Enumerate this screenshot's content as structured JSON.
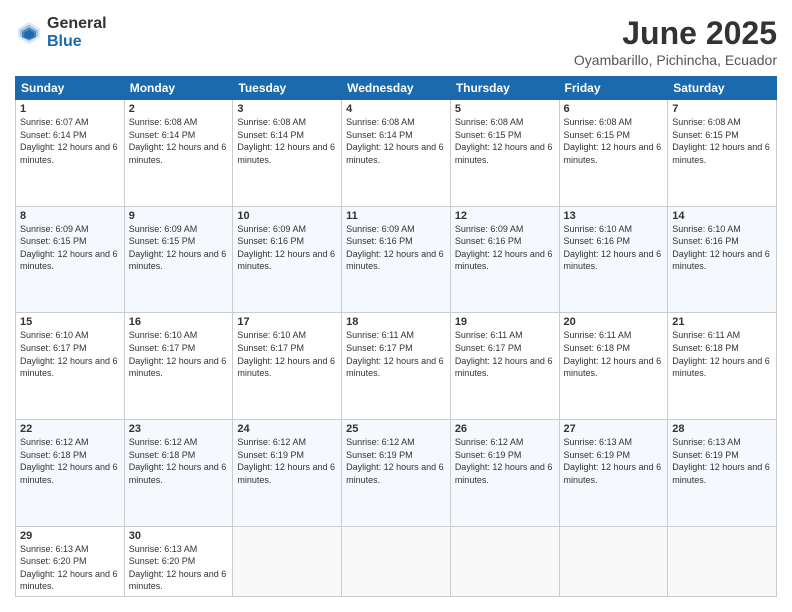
{
  "logo": {
    "general": "General",
    "blue": "Blue"
  },
  "title": "June 2025",
  "location": "Oyambarillo, Pichincha, Ecuador",
  "headers": [
    "Sunday",
    "Monday",
    "Tuesday",
    "Wednesday",
    "Thursday",
    "Friday",
    "Saturday"
  ],
  "weeks": [
    [
      {
        "day": "1",
        "sunrise": "6:07 AM",
        "sunset": "6:14 PM",
        "daylight": "12 hours and 6 minutes."
      },
      {
        "day": "2",
        "sunrise": "6:08 AM",
        "sunset": "6:14 PM",
        "daylight": "12 hours and 6 minutes."
      },
      {
        "day": "3",
        "sunrise": "6:08 AM",
        "sunset": "6:14 PM",
        "daylight": "12 hours and 6 minutes."
      },
      {
        "day": "4",
        "sunrise": "6:08 AM",
        "sunset": "6:14 PM",
        "daylight": "12 hours and 6 minutes."
      },
      {
        "day": "5",
        "sunrise": "6:08 AM",
        "sunset": "6:15 PM",
        "daylight": "12 hours and 6 minutes."
      },
      {
        "day": "6",
        "sunrise": "6:08 AM",
        "sunset": "6:15 PM",
        "daylight": "12 hours and 6 minutes."
      },
      {
        "day": "7",
        "sunrise": "6:08 AM",
        "sunset": "6:15 PM",
        "daylight": "12 hours and 6 minutes."
      }
    ],
    [
      {
        "day": "8",
        "sunrise": "6:09 AM",
        "sunset": "6:15 PM",
        "daylight": "12 hours and 6 minutes."
      },
      {
        "day": "9",
        "sunrise": "6:09 AM",
        "sunset": "6:15 PM",
        "daylight": "12 hours and 6 minutes."
      },
      {
        "day": "10",
        "sunrise": "6:09 AM",
        "sunset": "6:16 PM",
        "daylight": "12 hours and 6 minutes."
      },
      {
        "day": "11",
        "sunrise": "6:09 AM",
        "sunset": "6:16 PM",
        "daylight": "12 hours and 6 minutes."
      },
      {
        "day": "12",
        "sunrise": "6:09 AM",
        "sunset": "6:16 PM",
        "daylight": "12 hours and 6 minutes."
      },
      {
        "day": "13",
        "sunrise": "6:10 AM",
        "sunset": "6:16 PM",
        "daylight": "12 hours and 6 minutes."
      },
      {
        "day": "14",
        "sunrise": "6:10 AM",
        "sunset": "6:16 PM",
        "daylight": "12 hours and 6 minutes."
      }
    ],
    [
      {
        "day": "15",
        "sunrise": "6:10 AM",
        "sunset": "6:17 PM",
        "daylight": "12 hours and 6 minutes."
      },
      {
        "day": "16",
        "sunrise": "6:10 AM",
        "sunset": "6:17 PM",
        "daylight": "12 hours and 6 minutes."
      },
      {
        "day": "17",
        "sunrise": "6:10 AM",
        "sunset": "6:17 PM",
        "daylight": "12 hours and 6 minutes."
      },
      {
        "day": "18",
        "sunrise": "6:11 AM",
        "sunset": "6:17 PM",
        "daylight": "12 hours and 6 minutes."
      },
      {
        "day": "19",
        "sunrise": "6:11 AM",
        "sunset": "6:17 PM",
        "daylight": "12 hours and 6 minutes."
      },
      {
        "day": "20",
        "sunrise": "6:11 AM",
        "sunset": "6:18 PM",
        "daylight": "12 hours and 6 minutes."
      },
      {
        "day": "21",
        "sunrise": "6:11 AM",
        "sunset": "6:18 PM",
        "daylight": "12 hours and 6 minutes."
      }
    ],
    [
      {
        "day": "22",
        "sunrise": "6:12 AM",
        "sunset": "6:18 PM",
        "daylight": "12 hours and 6 minutes."
      },
      {
        "day": "23",
        "sunrise": "6:12 AM",
        "sunset": "6:18 PM",
        "daylight": "12 hours and 6 minutes."
      },
      {
        "day": "24",
        "sunrise": "6:12 AM",
        "sunset": "6:19 PM",
        "daylight": "12 hours and 6 minutes."
      },
      {
        "day": "25",
        "sunrise": "6:12 AM",
        "sunset": "6:19 PM",
        "daylight": "12 hours and 6 minutes."
      },
      {
        "day": "26",
        "sunrise": "6:12 AM",
        "sunset": "6:19 PM",
        "daylight": "12 hours and 6 minutes."
      },
      {
        "day": "27",
        "sunrise": "6:13 AM",
        "sunset": "6:19 PM",
        "daylight": "12 hours and 6 minutes."
      },
      {
        "day": "28",
        "sunrise": "6:13 AM",
        "sunset": "6:19 PM",
        "daylight": "12 hours and 6 minutes."
      }
    ],
    [
      {
        "day": "29",
        "sunrise": "6:13 AM",
        "sunset": "6:20 PM",
        "daylight": "12 hours and 6 minutes."
      },
      {
        "day": "30",
        "sunrise": "6:13 AM",
        "sunset": "6:20 PM",
        "daylight": "12 hours and 6 minutes."
      },
      null,
      null,
      null,
      null,
      null
    ]
  ],
  "labels": {
    "sunrise_prefix": "Sunrise: ",
    "sunset_prefix": "Sunset: ",
    "daylight_prefix": "Daylight: "
  }
}
